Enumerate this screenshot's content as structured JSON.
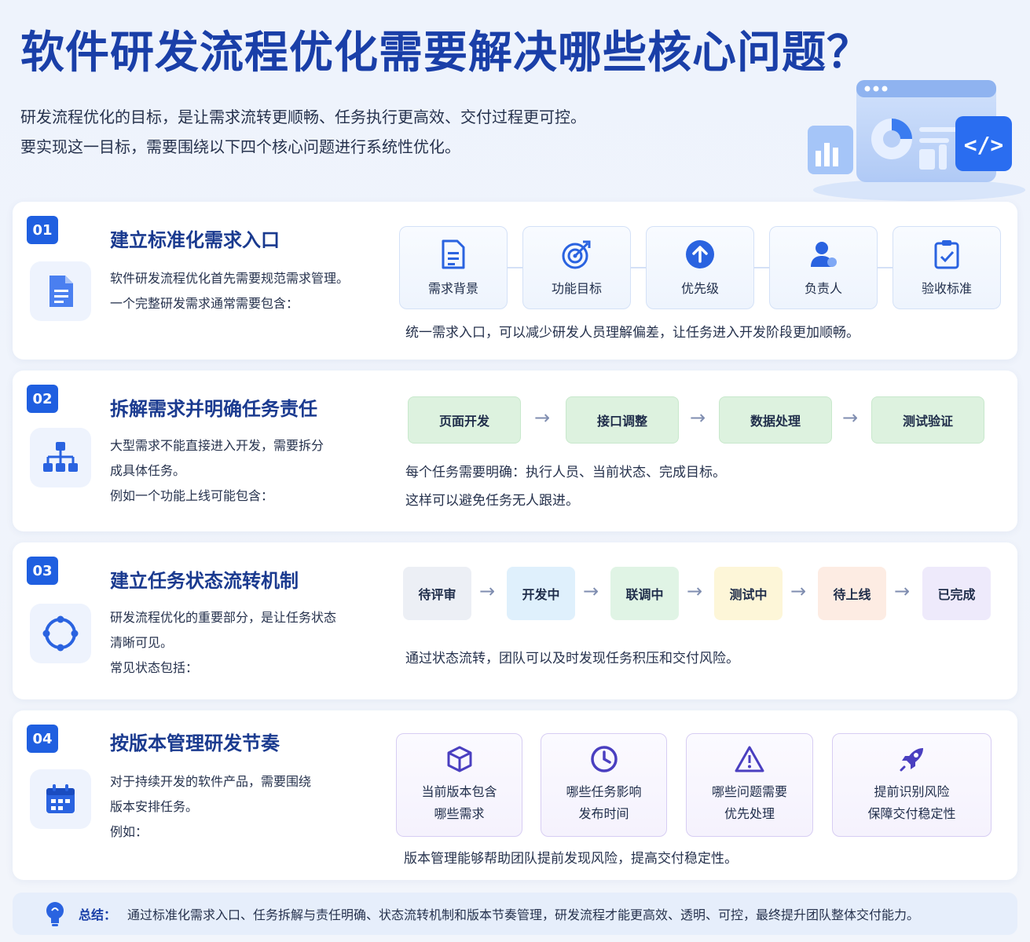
{
  "title": "软件研发流程优化需要解决哪些核心问题？",
  "subtitle": [
    "研发流程优化的目标，是让需求流转更顺畅、任务执行更高效、交付过程更可控。",
    "要实现这一目标，需要围绕以下四个核心问题进行系统性优化。"
  ],
  "colors": {
    "title": "#1a3fa8",
    "accent": "#1f5fe0",
    "green_box": "#ddf2df",
    "purple_border": "#d7cdf3"
  },
  "sections": [
    {
      "num": "01",
      "icon": "document-icon",
      "title": "建立标准化需求入口",
      "desc": [
        "软件研发流程优化首先需要规范需求管理。",
        "一个完整研发需求通常需要包含："
      ],
      "items": [
        {
          "label": "需求背景",
          "icon": "document-lines-icon"
        },
        {
          "label": "功能目标",
          "icon": "target-icon"
        },
        {
          "label": "优先级",
          "icon": "arrow-up-circle-icon"
        },
        {
          "label": "负责人",
          "icon": "person-icon"
        },
        {
          "label": "验收标准",
          "icon": "checklist-icon"
        }
      ],
      "note": [
        "统一需求入口，可以减少研发人员理解偏差，让任务进入开发阶段更加顺畅。"
      ]
    },
    {
      "num": "02",
      "icon": "hierarchy-icon",
      "title": "拆解需求并明确任务责任",
      "desc": [
        "大型需求不能直接进入开发，需要拆分",
        "成具体任务。",
        "例如一个功能上线可能包含："
      ],
      "items": [
        {
          "label": "页面开发"
        },
        {
          "label": "接口调整"
        },
        {
          "label": "数据处理"
        },
        {
          "label": "测试验证"
        }
      ],
      "note": [
        "每个任务需要明确：执行人员、当前状态、完成目标。",
        "这样可以避免任务无人跟进。"
      ]
    },
    {
      "num": "03",
      "icon": "cycle-icon",
      "title": "建立任务状态流转机制",
      "desc": [
        "研发流程优化的重要部分，是让任务状态",
        "清晰可见。",
        "常见状态包括："
      ],
      "items": [
        {
          "label": "待评审",
          "color": "#eceff5"
        },
        {
          "label": "开发中",
          "color": "#dff0fc"
        },
        {
          "label": "联调中",
          "color": "#e0f4e5"
        },
        {
          "label": "测试中",
          "color": "#fdf6d8"
        },
        {
          "label": "待上线",
          "color": "#fdece3"
        },
        {
          "label": "已完成",
          "color": "#eeeafb"
        }
      ],
      "note": [
        "通过状态流转，团队可以及时发现任务积压和交付风险。"
      ]
    },
    {
      "num": "04",
      "icon": "calendar-icon",
      "title": "按版本管理研发节奏",
      "desc": [
        "对于持续开发的软件产品，需要围绕",
        "版本安排任务。",
        "例如："
      ],
      "items": [
        {
          "lines": [
            "当前版本包含",
            "哪些需求"
          ],
          "icon": "cube-icon"
        },
        {
          "lines": [
            "哪些任务影响",
            "发布时间"
          ],
          "icon": "clock-icon"
        },
        {
          "lines": [
            "哪些问题需要",
            "优先处理"
          ],
          "icon": "warning-icon"
        },
        {
          "lines": [
            "提前识别风险",
            "保障交付稳定性"
          ],
          "icon": "rocket-icon"
        }
      ],
      "note": [
        "版本管理能够帮助团队提前发现风险，提高交付稳定性。"
      ]
    }
  ],
  "summary": {
    "label": "总结：",
    "text": "通过标准化需求入口、任务拆解与责任明确、状态流转机制和版本节奏管理，研发流程才能更高效、透明、可控，最终提升团队整体交付能力。",
    "icon": "lightbulb-icon"
  }
}
